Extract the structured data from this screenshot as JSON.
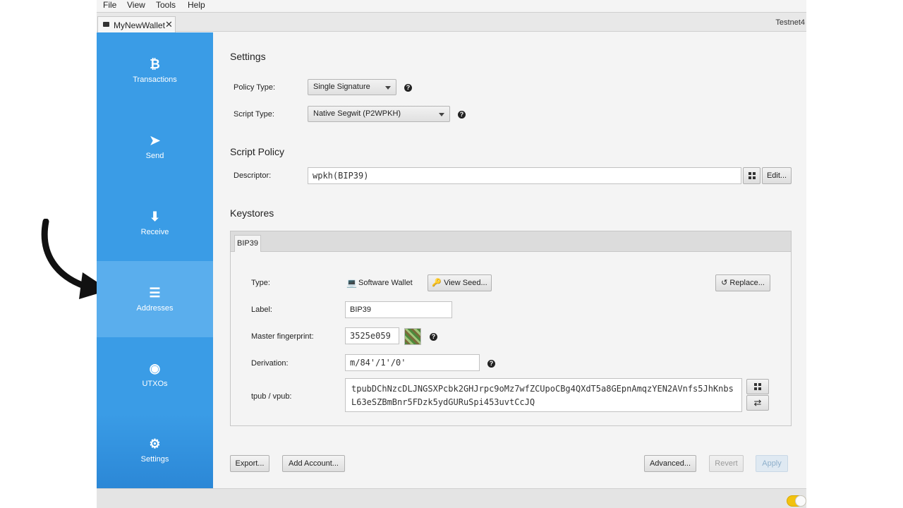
{
  "menu": [
    "File",
    "View",
    "Tools",
    "Help"
  ],
  "tabs": {
    "wallet_name": "MyNewWallet",
    "network": "Testnet4"
  },
  "sidebar": {
    "items": [
      {
        "label": "Transactions",
        "icon": "bitcoin-icon",
        "glyph": "₿"
      },
      {
        "label": "Send",
        "icon": "send-icon",
        "glyph": "➤"
      },
      {
        "label": "Receive",
        "icon": "arrow-down-icon",
        "glyph": "⬇"
      },
      {
        "label": "Addresses",
        "icon": "list-icon",
        "glyph": "☰"
      },
      {
        "label": "UTXOs",
        "icon": "coins-icon",
        "glyph": "◉"
      },
      {
        "label": "Settings",
        "icon": "gear-icon",
        "glyph": "⚙"
      }
    ],
    "active": "Addresses"
  },
  "settings": {
    "title": "Settings",
    "policy_type_label": "Policy Type:",
    "policy_type_value": "Single Signature",
    "script_type_label": "Script Type:",
    "script_type_value": "Native Segwit (P2WPKH)",
    "help_glyph": "?"
  },
  "script_policy": {
    "title": "Script Policy",
    "descriptor_label": "Descriptor:",
    "descriptor_value": "wpkh(BIP39)",
    "edit_label": "Edit..."
  },
  "keystores": {
    "title": "Keystores",
    "tab_label": "BIP39",
    "type_label": "Type:",
    "type_value": "Software Wallet",
    "view_seed_label": "View Seed...",
    "replace_label": "Replace...",
    "label_label": "Label:",
    "label_value": "BIP39",
    "fingerprint_label": "Master fingerprint:",
    "fingerprint_value": "3525e059",
    "derivation_label": "Derivation:",
    "derivation_value": "m/84'/1'/0'",
    "xpub_label": "tpub / vpub:",
    "xpub_value": "tpubDChNzcDLJNGSXPcbk2GHJrpc9oMz7wfZCUpoCBg4QXdT5a8GEpnAmqzYEN2AVnfs5JhKnbsL63eSZBmBnr5FDzk5ydGURuSpi453uvtCcJQ",
    "swap_glyph": "⇄"
  },
  "footer": {
    "export_label": "Export...",
    "add_account_label": "Add Account...",
    "advanced_label": "Advanced...",
    "revert_label": "Revert",
    "apply_label": "Apply"
  },
  "colors": {
    "sidebar": "#3a9ce6",
    "sidebar_active": "#5aaeed",
    "toggle": "#f2c20f"
  }
}
